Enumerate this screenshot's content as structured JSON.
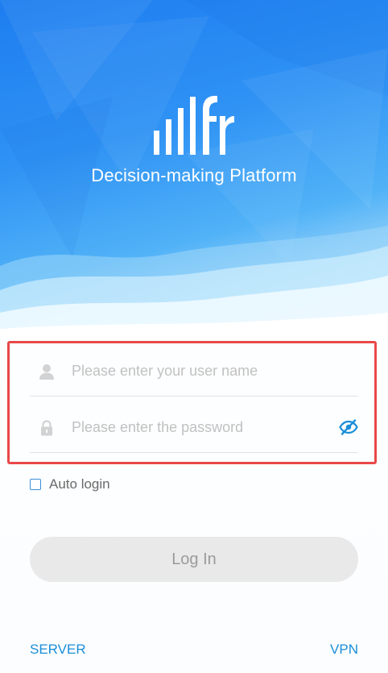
{
  "header": {
    "title": "Decision-making Platform",
    "logo_icon": "fr-bars-logo"
  },
  "form": {
    "username": {
      "icon": "user-icon",
      "placeholder": "Please enter your user name",
      "value": ""
    },
    "password": {
      "icon": "lock-icon",
      "placeholder": "Please enter the password",
      "value": "",
      "toggle_icon": "eye-hidden-icon"
    },
    "auto_login": {
      "label": "Auto login",
      "checked": false
    },
    "login_button_label": "Log In"
  },
  "footer": {
    "server_label": "SERVER",
    "vpn_label": "VPN"
  },
  "colors": {
    "primary_blue": "#1d7df0",
    "link_blue": "#1c8ed8",
    "highlight_red": "#e94848",
    "button_gray": "#e9e9e9"
  }
}
